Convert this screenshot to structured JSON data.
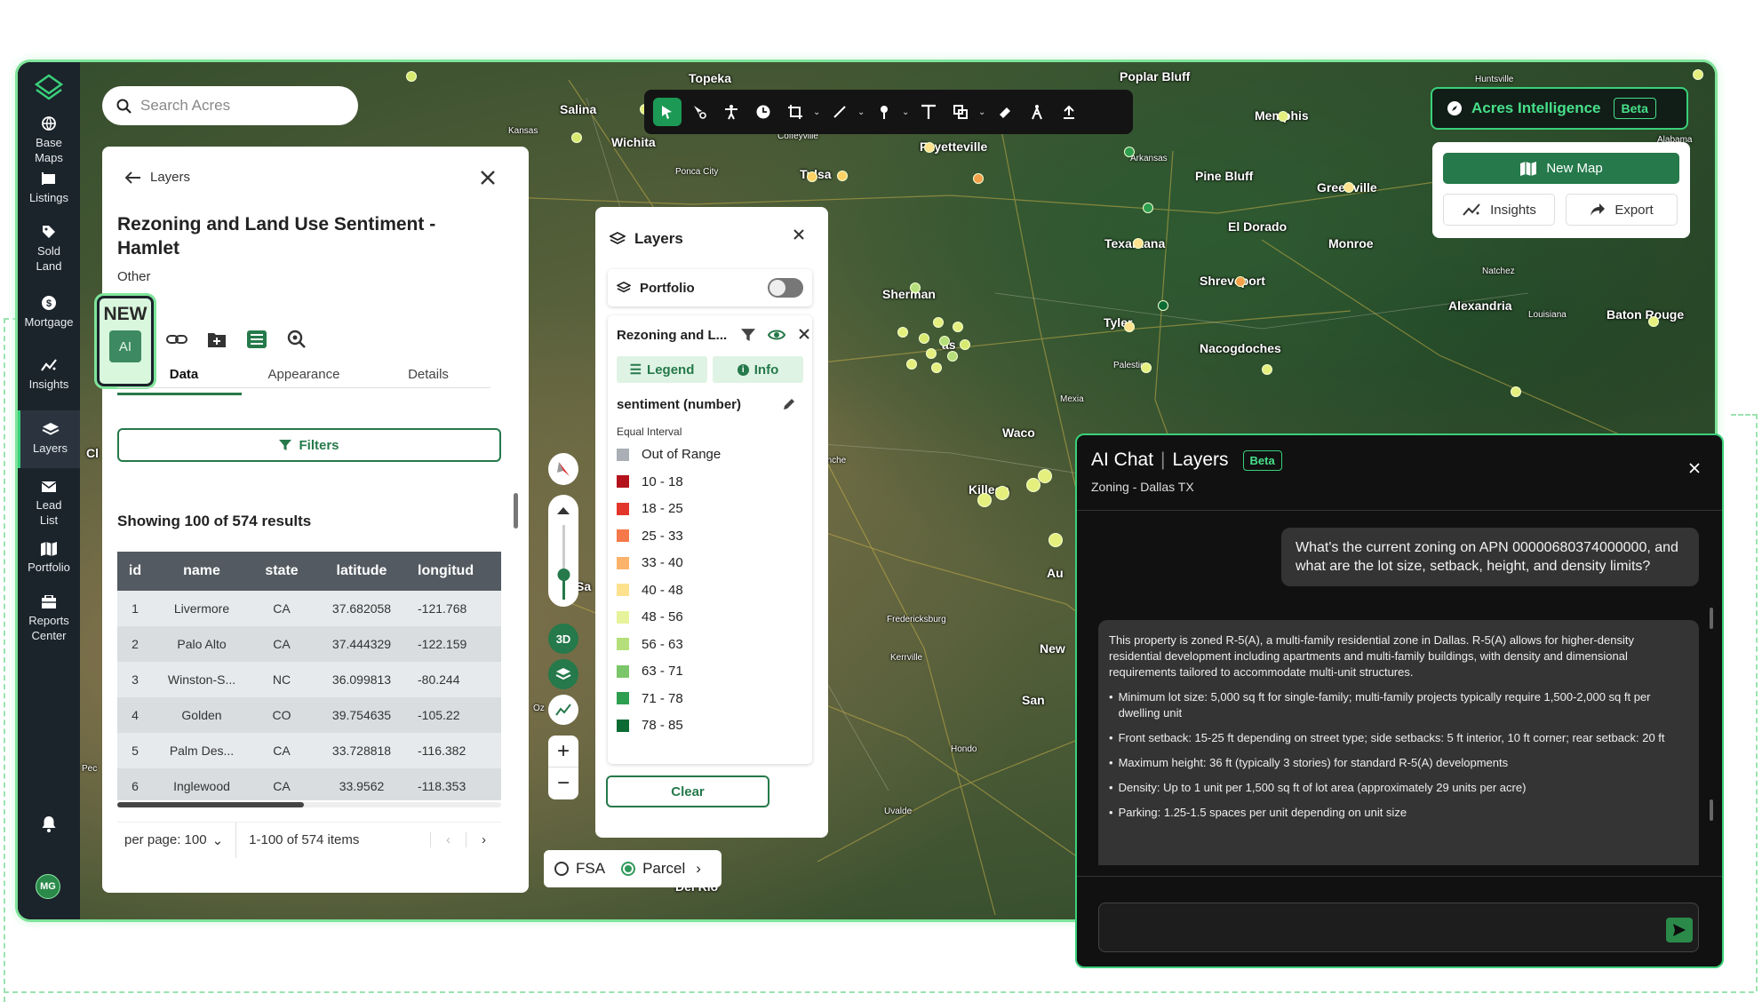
{
  "sidebar": {
    "items": [
      {
        "label1": "Base",
        "label2": "Maps",
        "icon": "globe-icon"
      },
      {
        "label1": "Listings",
        "label2": "",
        "icon": "listings-icon"
      },
      {
        "label1": "Sold",
        "label2": "Land",
        "icon": "tag-icon"
      },
      {
        "label1": "Mortgage",
        "label2": "",
        "icon": "dollar-icon"
      },
      {
        "label1": "Insights",
        "label2": "",
        "icon": "insights-icon"
      },
      {
        "label1": "Layers",
        "label2": "",
        "icon": "layers-icon"
      },
      {
        "label1": "Lead",
        "label2": "List",
        "icon": "mail-icon"
      },
      {
        "label1": "Portfolio",
        "label2": "",
        "icon": "map-icon"
      },
      {
        "label1": "Reports",
        "label2": "Center",
        "icon": "reports-icon"
      }
    ],
    "avatar": "MG"
  },
  "search": {
    "placeholder": "Search Acres"
  },
  "acres_intelligence": {
    "label": "Acres Intelligence",
    "badge": "Beta"
  },
  "actions": {
    "new_map": "New Map",
    "insights": "Insights",
    "export": "Export"
  },
  "detail": {
    "back_label": "Layers",
    "title_line1": "Rezoning and Land Use Sentiment -",
    "title_line2": "Hamlet",
    "category": "Other",
    "new_badge": "NEW",
    "ai_badge": "AI",
    "tabs": [
      "Data",
      "Appearance",
      "Details"
    ],
    "filters_label": "Filters",
    "results_text": "Showing 100 of 574 results",
    "columns": [
      "id",
      "name",
      "state",
      "latitude",
      "longitud"
    ],
    "rows": [
      [
        "1",
        "Livermore",
        "CA",
        "37.682058",
        "-121.768"
      ],
      [
        "2",
        "Palo Alto",
        "CA",
        "37.444329",
        "-122.159"
      ],
      [
        "3",
        "Winston-S...",
        "NC",
        "36.099813",
        "-80.244"
      ],
      [
        "4",
        "Golden",
        "CO",
        "39.754635",
        "-105.22"
      ],
      [
        "5",
        "Palm Des...",
        "CA",
        "33.728818",
        "-116.382"
      ],
      [
        "6",
        "Inglewood",
        "CA",
        "33.9562",
        "-118.353"
      ]
    ],
    "per_page": "per page: 100",
    "range": "1-100 of 574 items"
  },
  "layers": {
    "title": "Layers",
    "portfolio": "Portfolio",
    "layer_name": "Rezoning and L...",
    "legend_btn": "Legend",
    "info_btn": "Info",
    "field": "sentiment (number)",
    "method": "Equal Interval",
    "legend": [
      {
        "label": "Out of Range",
        "color": "#a9afb4"
      },
      {
        "label": "10 - 18",
        "color": "#b3121c"
      },
      {
        "label": "18 - 25",
        "color": "#e3362b"
      },
      {
        "label": "25 - 33",
        "color": "#f4784a"
      },
      {
        "label": "33 - 40",
        "color": "#fbb36b"
      },
      {
        "label": "40 - 48",
        "color": "#fde18f"
      },
      {
        "label": "48 - 56",
        "color": "#e7f39a"
      },
      {
        "label": "56 - 63",
        "color": "#b5df7a"
      },
      {
        "label": "63 - 71",
        "color": "#7bc66a"
      },
      {
        "label": "71 - 78",
        "color": "#2e9e4f"
      },
      {
        "label": "78 - 85",
        "color": "#0b6b33"
      }
    ],
    "clear": "Clear"
  },
  "map_controls": {
    "three_d": "3D"
  },
  "view_toggle": {
    "fsa": "FSA",
    "parcel": "Parcel"
  },
  "map_labels": [
    "Topeka",
    "Salina",
    "Wichita",
    "Coffeyville",
    "Ponca City",
    "Tulsa",
    "Fayetteville",
    "Poplar Bluff",
    "Huntsville",
    "Memphis",
    "Pine Bluff",
    "Greenville",
    "El Dorado",
    "Texarkana",
    "Monroe",
    "Natchez",
    "Shreveport",
    "Sherman",
    "Tyler",
    "Alexandria",
    "Louisiana",
    "Baton Rouge",
    "Nacogdoches",
    "Palestine",
    "Mexia",
    "Waco",
    "Killeen",
    "Fredericksburg",
    "Kerrville",
    "New",
    "San",
    "Hondo",
    "Uvalde",
    "Del Rio",
    "Kansas",
    "Arkansas",
    "Alabama",
    "Cl",
    "Pec",
    "Oz",
    "Au",
    "Sa",
    "anche",
    "as"
  ],
  "chat": {
    "title_a": "AI Chat",
    "title_b": "Layers",
    "badge": "Beta",
    "subtitle": "Zoning - Dallas TX",
    "question": "What's the current zoning on APN 00000680374000000, and what are the lot size, setback, height, and density limits?",
    "answer_intro": "This property is zoned R-5(A), a multi-family residential zone in Dallas. R-5(A) allows for higher-density residential development including apartments and multi-family buildings, with density and dimensional requirements tailored to accommodate multi-unit structures.",
    "bullets": [
      "Minimum lot size: 5,000 sq ft for single-family; multi-family projects typically require 1,500-2,000 sq ft per dwelling unit",
      "Front setback: 15-25 ft depending on street type; side setbacks: 5 ft interior, 10 ft corner; rear setback: 20 ft",
      "Maximum height: 36 ft (typically 3 stories) for standard R-5(A) developments",
      "Density: Up to 1 unit per 1,500 sq ft of lot area (approximately 29 units per acre)",
      "Parking: 1.25-1.5 spaces per unit depending on unit size"
    ]
  },
  "colors": {
    "accent": "#25794a",
    "brand_green": "#3ad07a",
    "sidebar": "#1b232b"
  }
}
